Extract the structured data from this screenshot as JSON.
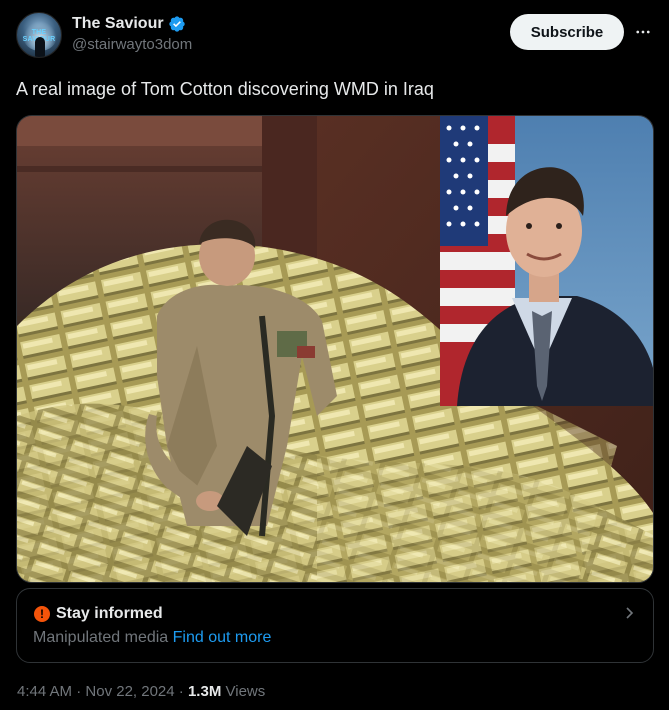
{
  "author": {
    "display_name": "The Saviour",
    "handle": "@stairwayto3dom",
    "avatar_text": "THE SAVIOUR"
  },
  "actions": {
    "subscribe_label": "Subscribe",
    "more_icon": "more-horizontal-icon"
  },
  "tweet": {
    "text": "A real image of Tom Cotton discovering WMD in Iraq"
  },
  "notice": {
    "title": "Stay informed",
    "body": "Manipulated media",
    "link": "Find out more"
  },
  "meta": {
    "time": "4:44 AM",
    "separator": "·",
    "date": "Nov 22, 2024",
    "views_count": "1.3M",
    "views_label": "Views"
  },
  "colors": {
    "background": "#000000",
    "accent": "#1d9bf0",
    "warning": "#f4540a",
    "muted": "#71767b",
    "text": "#e7e9ea"
  }
}
